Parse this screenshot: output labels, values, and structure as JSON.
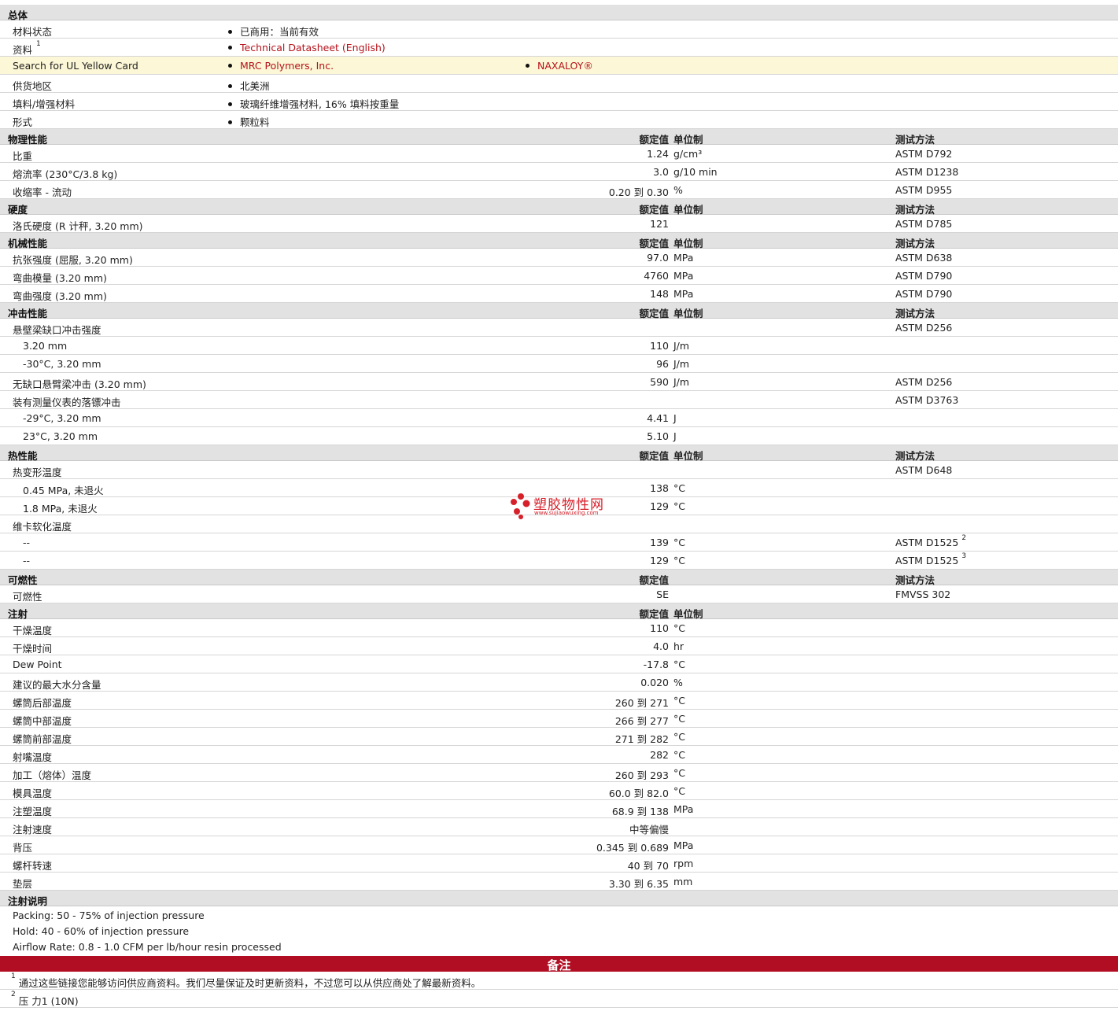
{
  "general": {
    "title": "总体",
    "rows": [
      {
        "label": "材料状态",
        "values": [
          "已商用：当前有效"
        ]
      },
      {
        "label": "资料",
        "sup": "1",
        "values": [
          "Technical Datasheet (English)"
        ],
        "link": true
      },
      {
        "label": "Search for UL Yellow Card",
        "values": [
          "MRC Polymers, Inc.",
          "NAXALOY®"
        ],
        "link": true
      },
      {
        "label": "供货地区",
        "values": [
          "北美洲"
        ]
      },
      {
        "label": "填料/增强材料",
        "values": [
          "玻璃纤维增强材料, 16% 填料按重量"
        ]
      },
      {
        "label": "形式",
        "values": [
          "颗粒料"
        ]
      }
    ]
  },
  "headers": {
    "nominal": "额定值",
    "unit": "单位制",
    "method": "测试方法"
  },
  "sections": [
    {
      "title": "物理性能",
      "show_unit": true,
      "show_method": true,
      "rows": [
        {
          "label": "比重",
          "value": "1.24",
          "unit": "g/cm³",
          "method": "ASTM D792"
        },
        {
          "label": "熔流率  (230°C/3.8 kg)",
          "value": "3.0",
          "unit": "g/10 min",
          "method": "ASTM D1238"
        },
        {
          "label": "收缩率  - 流动",
          "value": "0.20 到  0.30",
          "unit": "%",
          "method": "ASTM D955"
        }
      ]
    },
    {
      "title": "硬度",
      "show_unit": true,
      "show_method": true,
      "rows": [
        {
          "label": "洛氏硬度  (R 计秤, 3.20 mm)",
          "value": "121",
          "unit": "",
          "method": "ASTM D785"
        }
      ]
    },
    {
      "title": "机械性能",
      "show_unit": true,
      "show_method": true,
      "rows": [
        {
          "label": "抗张强度  (屈服, 3.20 mm)",
          "value": "97.0",
          "unit": "MPa",
          "method": "ASTM D638"
        },
        {
          "label": "弯曲模量  (3.20 mm)",
          "value": "4760",
          "unit": "MPa",
          "method": "ASTM D790"
        },
        {
          "label": "弯曲强度  (3.20 mm)",
          "value": "148",
          "unit": "MPa",
          "method": "ASTM D790"
        }
      ]
    },
    {
      "title": "冲击性能",
      "show_unit": true,
      "show_method": true,
      "rows": [
        {
          "label": "悬壁梁缺口冲击强度",
          "value": "",
          "unit": "",
          "method": "ASTM D256"
        },
        {
          "label": "3.20 mm",
          "sub": true,
          "value": "110",
          "unit": "J/m",
          "method": ""
        },
        {
          "label": "-30°C, 3.20 mm",
          "sub": true,
          "value": "96",
          "unit": "J/m",
          "method": ""
        },
        {
          "label": "无缺口悬臂梁冲击  (3.20 mm)",
          "value": "590",
          "unit": "J/m",
          "method": "ASTM D256"
        },
        {
          "label": "装有测量仪表的落镖冲击",
          "value": "",
          "unit": "",
          "method": "ASTM D3763"
        },
        {
          "label": "-29°C, 3.20 mm",
          "sub": true,
          "value": "4.41",
          "unit": "J",
          "method": ""
        },
        {
          "label": "23°C, 3.20 mm",
          "sub": true,
          "value": "5.10",
          "unit": "J",
          "method": ""
        }
      ]
    },
    {
      "title": "热性能",
      "show_unit": true,
      "show_method": true,
      "rows": [
        {
          "label": "热变形温度",
          "value": "",
          "unit": "",
          "method": "ASTM D648"
        },
        {
          "label": "0.45 MPa, 未退火",
          "sub": true,
          "value": "138",
          "unit": "°C",
          "method": ""
        },
        {
          "label": "1.8 MPa, 未退火",
          "sub": true,
          "value": "129",
          "unit": "°C",
          "method": ""
        },
        {
          "label": "维卡软化温度",
          "value": "",
          "unit": "",
          "method": ""
        },
        {
          "label": "--",
          "sub": true,
          "value": "139",
          "unit": "°C",
          "method": "ASTM D1525",
          "method_sup": "2"
        },
        {
          "label": "--",
          "sub": true,
          "value": "129",
          "unit": "°C",
          "method": "ASTM D1525",
          "method_sup": "3"
        }
      ]
    },
    {
      "title": "可燃性",
      "show_unit": false,
      "show_method": true,
      "rows": [
        {
          "label": "可燃性",
          "value": "SE",
          "unit": "",
          "method": "FMVSS 302"
        }
      ]
    },
    {
      "title": "注射",
      "show_unit": true,
      "show_method": false,
      "rows": [
        {
          "label": "干燥温度",
          "value": "110",
          "unit": "°C",
          "method": ""
        },
        {
          "label": "干燥时间",
          "value": "4.0",
          "unit": "hr",
          "method": ""
        },
        {
          "label": "Dew Point",
          "value": "-17.8",
          "unit": "°C",
          "method": ""
        },
        {
          "label": "建议的最大水分含量",
          "value": "0.020",
          "unit": "%",
          "method": ""
        },
        {
          "label": "螺筒后部温度",
          "value": "260 到  271",
          "unit": "°C",
          "method": ""
        },
        {
          "label": "螺筒中部温度",
          "value": "266 到  277",
          "unit": "°C",
          "method": ""
        },
        {
          "label": "螺筒前部温度",
          "value": "271 到  282",
          "unit": "°C",
          "method": ""
        },
        {
          "label": "射嘴温度",
          "value": "282",
          "unit": "°C",
          "method": ""
        },
        {
          "label": "加工（熔体）温度",
          "value": "260 到  293",
          "unit": "°C",
          "method": ""
        },
        {
          "label": "模具温度",
          "value": "60.0 到  82.0",
          "unit": "°C",
          "method": ""
        },
        {
          "label": "注塑温度",
          "value": "68.9 到  138",
          "unit": "MPa",
          "method": ""
        },
        {
          "label": "注射速度",
          "value": "中等偏慢",
          "unit": "",
          "method": ""
        },
        {
          "label": "背压",
          "value": "0.345 到  0.689",
          "unit": "MPa",
          "method": ""
        },
        {
          "label": "螺杆转速",
          "value": "40 到  70",
          "unit": "rpm",
          "method": ""
        },
        {
          "label": "垫层",
          "value": "3.30 到  6.35",
          "unit": "mm",
          "method": ""
        }
      ]
    }
  ],
  "injection_notes": {
    "title": "注射说明",
    "lines": [
      "Packing: 50 - 75% of injection pressure",
      "Hold: 40 - 60% of injection pressure",
      "Airflow Rate: 0.8 - 1.0 CFM per lb/hour resin processed"
    ]
  },
  "remarks": {
    "title": "备注",
    "footnotes": [
      {
        "num": "1",
        "text": "通过这些链接您能够访问供应商资料。我们尽量保证及时更新资料，不过您可以从供应商处了解最新资料。"
      },
      {
        "num": "2",
        "text": "压  力1 (10N)"
      }
    ]
  },
  "watermark": {
    "name": "塑胶物性网",
    "url": "www.sujiaowuxing.com"
  },
  "colors": {
    "link": "#b5121b",
    "section_bg": "#e2e2e2",
    "highlight_bg": "#fcf7d6",
    "remarks_bar": "#b10d23"
  }
}
